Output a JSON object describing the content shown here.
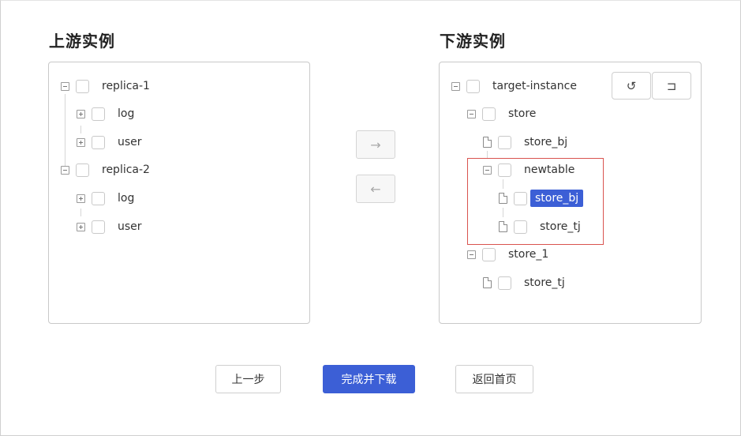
{
  "upstream": {
    "title": "上游实例",
    "tree": [
      {
        "label": "replica-1",
        "children": [
          {
            "label": "log"
          },
          {
            "label": "user"
          }
        ]
      },
      {
        "label": "replica-2",
        "children": [
          {
            "label": "log"
          },
          {
            "label": "user"
          }
        ]
      }
    ]
  },
  "downstream": {
    "title": "下游实例",
    "root": "target-instance",
    "store": "store",
    "store_bj": "store_bj",
    "newtable": "newtable",
    "newtable_store_bj": "store_bj",
    "newtable_store_tj": "store_tj",
    "store_1": "store_1",
    "store_1_store_tj": "store_tj",
    "undo_icon": "↺",
    "return_icon": "⊐"
  },
  "transfer": {
    "right_arrow": "→",
    "left_arrow": "←"
  },
  "footer": {
    "prev_label": "上一步",
    "finish_label": "完成并下载",
    "home_label": "返回首页"
  }
}
